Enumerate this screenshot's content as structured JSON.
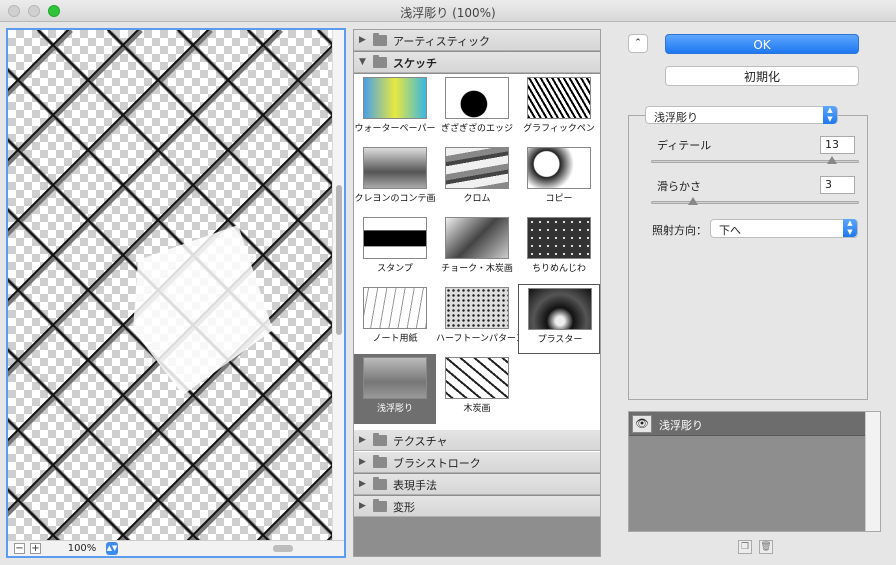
{
  "window": {
    "title": "浅浮彫り (100%)"
  },
  "preview": {
    "zoom_out": "−",
    "zoom_in": "+",
    "zoom_value": "100%"
  },
  "gallery": {
    "categories_top": [
      {
        "label": "アーティスティック",
        "open": false
      },
      {
        "label": "スケッチ",
        "open": true
      }
    ],
    "tiles": [
      "ウォーターペーパー",
      "ぎざぎざのエッジ",
      "グラフィックペン",
      "クレヨンのコンテ画",
      "クロム",
      "コピー",
      "スタンプ",
      "チョーク・木炭画",
      "ちりめんじわ",
      "ノート用紙",
      "ハーフトーンパターン",
      "プラスター",
      "浅浮彫り",
      "木炭画"
    ],
    "categories_bottom": [
      {
        "label": "テクスチャ"
      },
      {
        "label": "ブラシストローク"
      },
      {
        "label": "表現手法"
      },
      {
        "label": "変形"
      }
    ]
  },
  "actions": {
    "collapse": "⌃",
    "ok": "OK",
    "reset": "初期化"
  },
  "settings": {
    "filter": "浅浮彫り",
    "detail_label": "ディテール",
    "detail_value": "13",
    "detail_fraction": 0.87,
    "smooth_label": "滑らかさ",
    "smooth_value": "3",
    "smooth_fraction": 0.2,
    "light_label": "照射方向：",
    "light_value": "下へ"
  },
  "layers": {
    "items": [
      {
        "name": "浅浮彫り",
        "visible": true
      }
    ]
  }
}
